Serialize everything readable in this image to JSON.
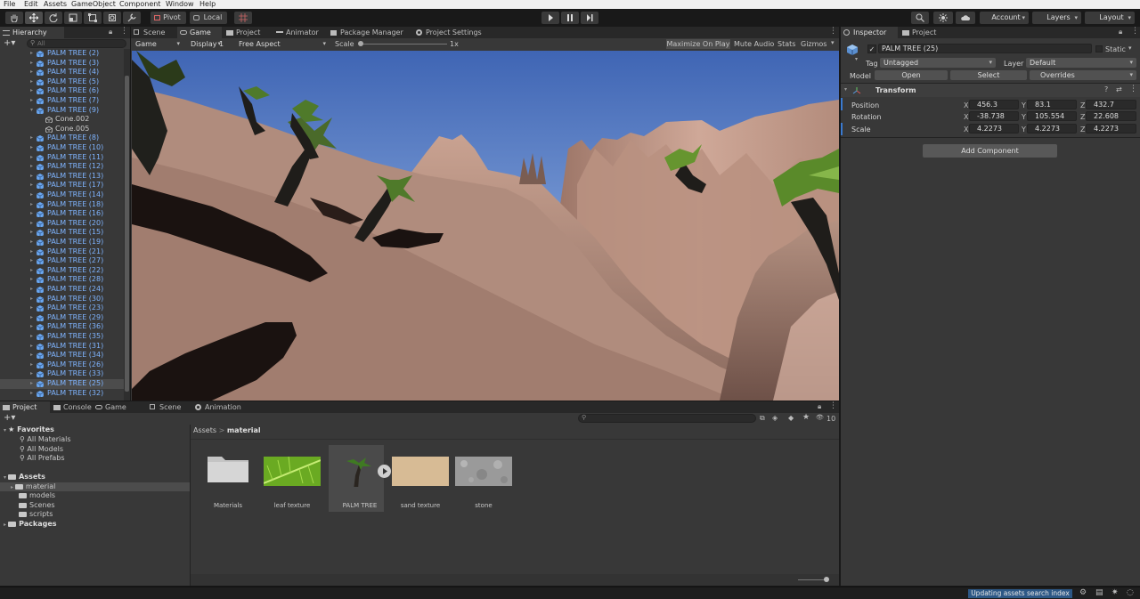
{
  "menu": [
    "File",
    "Edit",
    "Assets",
    "GameObject",
    "Component",
    "Window",
    "Help"
  ],
  "toolbar": {
    "pivot": "Pivot",
    "local": "Local",
    "account": "Account",
    "layers": "Layers",
    "layout": "Layout"
  },
  "center_tabs": [
    "Scene",
    "Game",
    "Project",
    "Animator",
    "Package Manager",
    "Project Settings"
  ],
  "game_bar": {
    "view": "Game",
    "display": "Display 1",
    "aspect": "Free Aspect",
    "scale_label": "Scale",
    "scale_value": "1x",
    "maximize": "Maximize On Play",
    "mute": "Mute Audio",
    "stats": "Stats",
    "gizmos": "Gizmos"
  },
  "hierarchy": {
    "title": "Hierarchy",
    "search_placeholder": "All",
    "items": [
      {
        "label": "PALM TREE (2)"
      },
      {
        "label": "PALM TREE (3)"
      },
      {
        "label": "PALM TREE (4)"
      },
      {
        "label": "PALM TREE (5)"
      },
      {
        "label": "PALM TREE (6)"
      },
      {
        "label": "PALM TREE (7)"
      },
      {
        "label": "PALM TREE (9)",
        "expanded": true
      },
      {
        "label": "Cone.002",
        "child": true
      },
      {
        "label": "Cone.005",
        "child": true
      },
      {
        "label": "PALM TREE (8)"
      },
      {
        "label": "PALM TREE (10)"
      },
      {
        "label": "PALM TREE (11)"
      },
      {
        "label": "PALM TREE (12)"
      },
      {
        "label": "PALM TREE (13)"
      },
      {
        "label": "PALM TREE (17)"
      },
      {
        "label": "PALM TREE (14)"
      },
      {
        "label": "PALM TREE (18)"
      },
      {
        "label": "PALM TREE (16)"
      },
      {
        "label": "PALM TREE (20)"
      },
      {
        "label": "PALM TREE (15)"
      },
      {
        "label": "PALM TREE (19)"
      },
      {
        "label": "PALM TREE (21)"
      },
      {
        "label": "PALM TREE (27)"
      },
      {
        "label": "PALM TREE (22)"
      },
      {
        "label": "PALM TREE (28)"
      },
      {
        "label": "PALM TREE (24)"
      },
      {
        "label": "PALM TREE (30)"
      },
      {
        "label": "PALM TREE (23)"
      },
      {
        "label": "PALM TREE (29)"
      },
      {
        "label": "PALM TREE (36)"
      },
      {
        "label": "PALM TREE (35)"
      },
      {
        "label": "PALM TREE (31)"
      },
      {
        "label": "PALM TREE (34)"
      },
      {
        "label": "PALM TREE (26)"
      },
      {
        "label": "PALM TREE (33)"
      },
      {
        "label": "PALM TREE (25)",
        "selected": true
      },
      {
        "label": "PALM TREE (32)"
      }
    ]
  },
  "inspector": {
    "tabs": [
      "Inspector",
      "Project"
    ],
    "object_name": "PALM TREE (25)",
    "static_label": "Static",
    "tag_label": "Tag",
    "tag_value": "Untagged",
    "layer_label": "Layer",
    "layer_value": "Default",
    "model_label": "Model",
    "open": "Open",
    "select": "Select",
    "overrides": "Overrides",
    "transform_title": "Transform",
    "position_label": "Position",
    "rotation_label": "Rotation",
    "scale_label": "Scale",
    "axis_x": "X",
    "axis_y": "Y",
    "axis_z": "Z",
    "position": {
      "x": "456.3",
      "y": "83.1",
      "z": "432.7"
    },
    "rotation": {
      "x": "-38.738",
      "y": "105.554",
      "z": "22.608"
    },
    "scale": {
      "x": "4.2273",
      "y": "4.2273",
      "z": "4.2273"
    },
    "add_component": "Add Component"
  },
  "bottom_tabs": [
    "Project",
    "Console",
    "Game",
    "Scene",
    "Animation"
  ],
  "project": {
    "hidden_count": "10",
    "favorites_label": "Favorites",
    "favorites": [
      "All Materials",
      "All Models",
      "All Prefabs"
    ],
    "assets_label": "Assets",
    "assets_tree": [
      "material",
      "models",
      "Scenes",
      "scripts"
    ],
    "packages_label": "Packages",
    "breadcrumb_root": "Assets",
    "breadcrumb_sep": ">",
    "breadcrumb_current": "material",
    "items": [
      "Materials",
      "leaf texture",
      "PALM TREE",
      "sand texture",
      "stone"
    ]
  },
  "status": {
    "text": "Updating assets search index"
  }
}
